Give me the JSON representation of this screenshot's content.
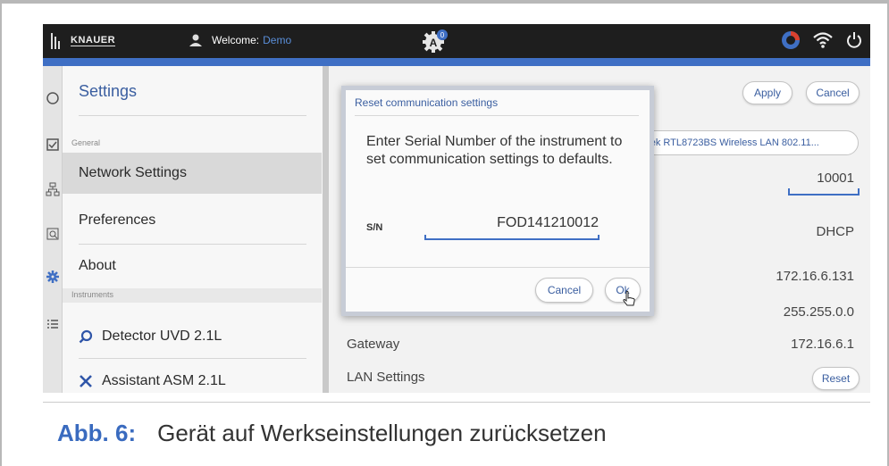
{
  "topbar": {
    "brand": "KNAUER",
    "welcome_label": "Welcome:",
    "user_name": "Demo",
    "notification_count": "0"
  },
  "sidebar": {
    "title": "Settings",
    "section_general": "General",
    "section_instruments": "Instruments",
    "items": [
      {
        "label": "Network Settings",
        "active": true
      },
      {
        "label": "Preferences",
        "active": false
      },
      {
        "label": "About",
        "active": false
      }
    ],
    "instruments": [
      {
        "label": "Detector UVD 2.1L",
        "icon": "search-icon"
      },
      {
        "label": "Assistant ASM 2.1L",
        "icon": "tools-icon"
      }
    ]
  },
  "network": {
    "apply_label": "Apply",
    "cancel_label": "Cancel",
    "wifi_adapter": "N: Realtek RTL8723BS Wireless LAN 802.11...",
    "port": "10001",
    "mode": "DHCP",
    "ip_address": "172.16.6.131",
    "subnet_mask": "255.255.0.0",
    "gateway_label": "Gateway",
    "gateway": "172.16.6.1",
    "lan_settings_label": "LAN Settings",
    "reset_label": "Reset"
  },
  "dialog": {
    "title": "Reset communication settings",
    "message": "Enter Serial Number of the instrument to set communication settings to defaults.",
    "sn_label": "S/N",
    "sn_value": "FOD141210012",
    "cancel_label": "Cancel",
    "ok_label": "Ok"
  },
  "caption": {
    "number": "Abb. 6:",
    "text": "Gerät auf Werkseinstellungen zurücksetzen"
  },
  "colors": {
    "accent": "#3f6fc4",
    "topbar": "#1e1e1e",
    "link_blue": "#3a5ea0"
  }
}
